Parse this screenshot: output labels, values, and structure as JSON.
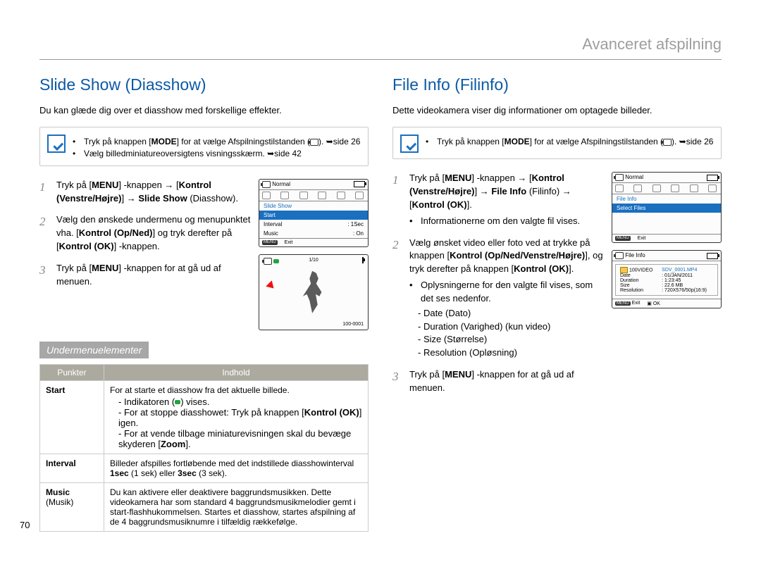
{
  "running_head": "Avanceret afspilning",
  "page_number": "70",
  "left": {
    "heading": "Slide Show (Diasshow)",
    "intro": "Du kan glæde dig over et diasshow med forskellige effekter.",
    "note": {
      "bullet1_a": "Tryk på knappen [",
      "bullet1_mode": "MODE",
      "bullet1_b": "] for at vælge Afspilningstilstanden (",
      "bullet1_c": "). ➥side 26",
      "bullet2": "Vælg billedminiatureoversigtens visningsskærm. ➥side 42"
    },
    "steps": {
      "s1_a": "Tryk på [",
      "s1_menu": "MENU",
      "s1_b": "] -knappen ",
      "s1_c": "Kontrol (Venstre/Højre)",
      "s1_d": " ",
      "s1_e": "Slide Show",
      "s1_f": " (Diasshow).",
      "s2_a": "Vælg den ønskede undermenu og menupunktet vha. [",
      "s2_b": "Kontrol (Op/Ned)",
      "s2_c": "] og tryk derefter på [",
      "s2_d": "Kontrol (OK)",
      "s2_e": "] -knappen.",
      "s3_a": "Tryk på [",
      "s3_menu": "MENU",
      "s3_b": "] -knappen for at gå ud af menuen."
    },
    "subsection": "Undermenuelementer",
    "table": {
      "head_punkter": "Punkter",
      "head_indhold": "Indhold",
      "rows": [
        {
          "k": "Start",
          "cell": {
            "l1": "For at starte et diasshow fra det aktuelle billede.",
            "l2a": "Indikatoren (",
            "l2b": ") vises.",
            "l3a": "For at stoppe diasshowet: Tryk på knappen [",
            "l3b": "Kontrol (OK)",
            "l3c": "] igen.",
            "l4a": "For at vende tilbage miniaturevisningen skal du bevæge skyderen [",
            "l4b": "Zoom",
            "l4c": "]."
          }
        },
        {
          "k": "Interval",
          "cell": {
            "t1": "Billeder afspilles fortløbende med det indstillede diasshowinterval ",
            "b1": "1sec",
            "t2": " (1 sek) eller ",
            "b2": "3sec",
            "t3": " (3 sek)."
          }
        },
        {
          "k": "Music",
          "k_sub": "(Musik)",
          "cell": {
            "t": "Du kan aktivere eller deaktivere baggrundsmusikken. Dette videokamera har som standard 4 baggrundsmusikmelodier gemt i start-flashhukommelsen. Startes et diasshow, startes afspilning af de 4 baggrundsmusiknumre i tilfældig rækkefølge."
          }
        }
      ]
    },
    "shot1": {
      "title": "Normal",
      "row1": "Slide Show",
      "row2": "Start",
      "row3": "Interval",
      "row3v": ": 1Sec",
      "row4": "Music",
      "row4v": ": On",
      "exit": "Exit",
      "menu": "MENU"
    },
    "shot2": {
      "counter": "1/10",
      "code": "100-0001"
    }
  },
  "right": {
    "heading": "File Info (Filinfo)",
    "intro": "Dette videokamera viser dig informationer om optagede billeder.",
    "note": {
      "a": "Tryk på knappen [",
      "mode": "MODE",
      "b": "] for at vælge Afspilningstilstanden (",
      "c": "). ➥side 26"
    },
    "steps": {
      "s1_a": "Tryk på [",
      "s1_menu": "MENU",
      "s1_b": "] -knappen ",
      "s1_c": "Kontrol (Venstre/Højre)",
      "s1_d": " ",
      "s1_e": "File Info",
      "s1_f": " (Filinfo) ",
      "s1_g": "Kontrol (OK)",
      "s1_h": "].",
      "s1_bullet": "Informationerne om den valgte fil vises.",
      "s2_a": "Vælg ønsket video eller foto ved at trykke på knappen [",
      "s2_b": "Kontrol (Op/Ned/Venstre/Højre)",
      "s2_c": "], og tryk derefter på knappen [",
      "s2_d": "Kontrol (OK)",
      "s2_e": "].",
      "s2_bullet": "Oplysningerne for den valgte fil vises, som det ses nedenfor.",
      "d1": "Date (Dato)",
      "d2": "Duration (Varighed) (kun video)",
      "d3": "Size (Størrelse)",
      "d4": "Resolution (Opløsning)",
      "s3_a": "Tryk på [",
      "s3_menu": "MENU",
      "s3_b": "] -knappen for at gå ud af menuen."
    },
    "shot1": {
      "title": "Normal",
      "row1": "File Info",
      "row2": "Select Files",
      "exit": "Exit",
      "menu": "MENU"
    },
    "shot2": {
      "title": "File Info",
      "folderlabel": "100VIDEO",
      "file": "SDV_0001.MP4",
      "date_k": "Date",
      "date_v": ": 01/JAN/2011",
      "dur_k": "Duration",
      "dur_v": ": 1:23:45",
      "size_k": "Size",
      "size_v": ": 22.6 MB",
      "res_k": "Resolution",
      "res_v": ": 720X576/50p(16:9)",
      "exit": "Exit",
      "ok": "OK",
      "menu": "MENU"
    }
  }
}
